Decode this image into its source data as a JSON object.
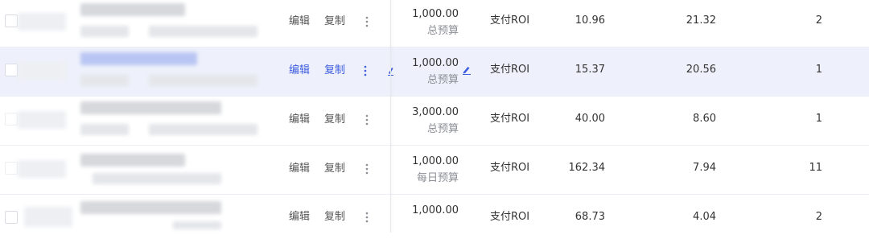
{
  "actions": {
    "edit_label": "编辑",
    "copy_label": "复制"
  },
  "colors": {
    "accent": "#3c5ce0",
    "selected_row_bg": "#eef1fb"
  },
  "rows": [
    {
      "budget_amount": "1,000.00",
      "budget_type": "总预算",
      "target": "支付ROI",
      "metric_a": "10.96",
      "metric_b": "21.32",
      "count": "2",
      "selected": false
    },
    {
      "budget_amount": "1,000.00",
      "budget_type": "总预算",
      "target": "支付ROI",
      "metric_a": "15.37",
      "metric_b": "20.56",
      "count": "1",
      "selected": true
    },
    {
      "budget_amount": "3,000.00",
      "budget_type": "总预算",
      "target": "支付ROI",
      "metric_a": "40.00",
      "metric_b": "8.60",
      "count": "1",
      "selected": false
    },
    {
      "budget_amount": "1,000.00",
      "budget_type": "每日预算",
      "target": "支付ROI",
      "metric_a": "162.34",
      "metric_b": "7.94",
      "count": "11",
      "selected": false
    },
    {
      "budget_amount": "1,000.00",
      "budget_type": "",
      "target": "支付ROI",
      "metric_a": "68.73",
      "metric_b": "4.04",
      "count": "2",
      "selected": false
    }
  ]
}
